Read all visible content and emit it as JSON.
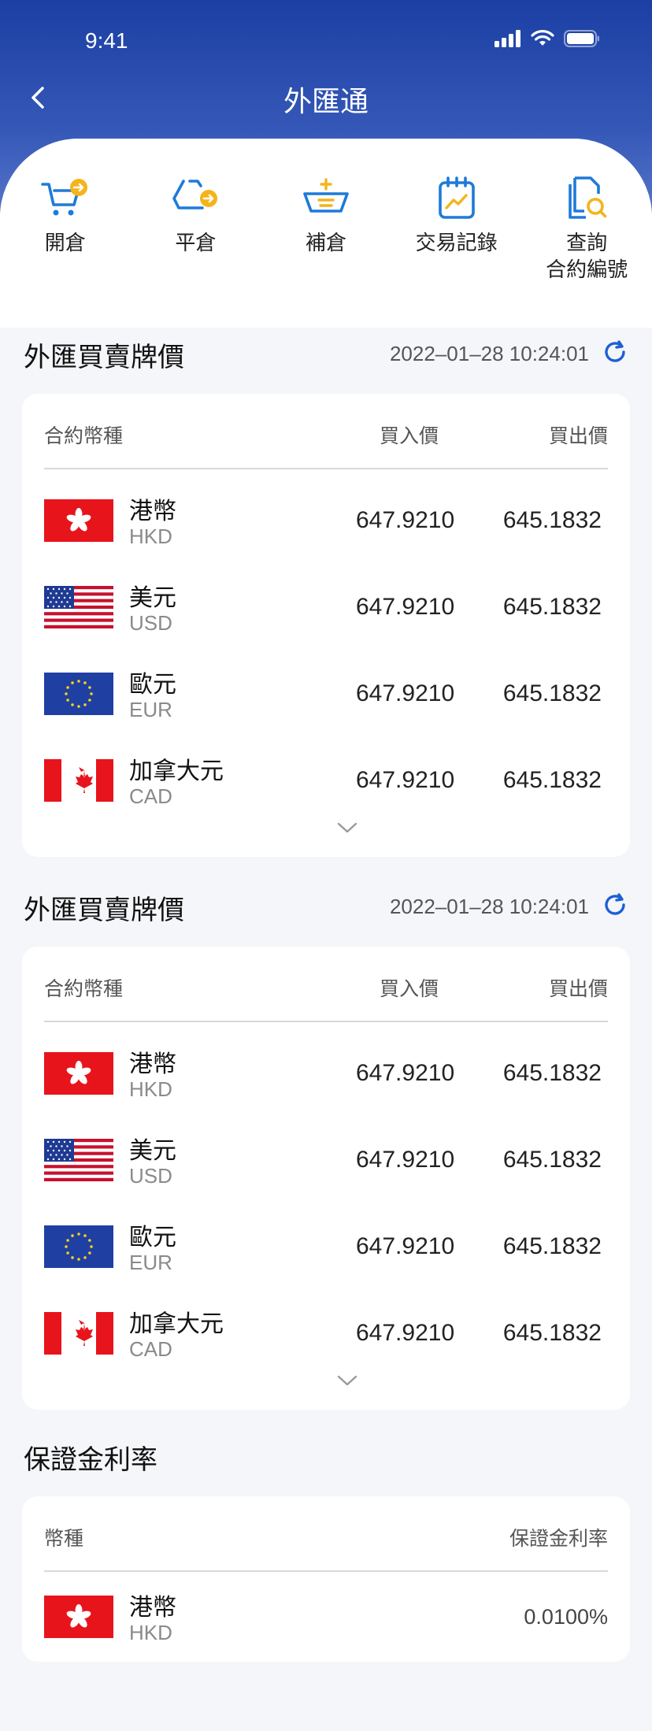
{
  "status_bar": {
    "time": "9:41"
  },
  "nav": {
    "title": "外匯通"
  },
  "quick_actions": [
    {
      "label": "開倉",
      "icon": "open-position-icon"
    },
    {
      "label": "平倉",
      "icon": "close-position-icon"
    },
    {
      "label": "補倉",
      "icon": "top-up-icon"
    },
    {
      "label": "交易記錄",
      "icon": "trade-record-icon"
    },
    {
      "label": "查詢\n合約編號",
      "icon": "search-contract-icon"
    }
  ],
  "rate_sections": [
    {
      "title": "外匯買賣牌價",
      "timestamp": "2022–01–28 10:24:01",
      "headers": {
        "currency": "合約幣種",
        "buy": "買入價",
        "sell": "買出價"
      },
      "rows": [
        {
          "name": "港幣",
          "code": "HKD",
          "buy": "647.9210",
          "sell": "645.1832",
          "flag": "hk-flag-icon"
        },
        {
          "name": "美元",
          "code": "USD",
          "buy": "647.9210",
          "sell": "645.1832",
          "flag": "us-flag-icon"
        },
        {
          "name": "歐元",
          "code": "EUR",
          "buy": "647.9210",
          "sell": "645.1832",
          "flag": "eu-flag-icon"
        },
        {
          "name": "加拿大元",
          "code": "CAD",
          "buy": "647.9210",
          "sell": "645.1832",
          "flag": "ca-flag-icon"
        }
      ]
    },
    {
      "title": "外匯買賣牌價",
      "timestamp": "2022–01–28 10:24:01",
      "headers": {
        "currency": "合約幣種",
        "buy": "買入價",
        "sell": "買出價"
      },
      "rows": [
        {
          "name": "港幣",
          "code": "HKD",
          "buy": "647.9210",
          "sell": "645.1832",
          "flag": "hk-flag-icon"
        },
        {
          "name": "美元",
          "code": "USD",
          "buy": "647.9210",
          "sell": "645.1832",
          "flag": "us-flag-icon"
        },
        {
          "name": "歐元",
          "code": "EUR",
          "buy": "647.9210",
          "sell": "645.1832",
          "flag": "eu-flag-icon"
        },
        {
          "name": "加拿大元",
          "code": "CAD",
          "buy": "647.9210",
          "sell": "645.1832",
          "flag": "ca-flag-icon"
        }
      ]
    }
  ],
  "margin_section": {
    "title": "保證金利率",
    "headers": {
      "currency": "幣種",
      "rate": "保證金利率"
    },
    "rows": [
      {
        "name": "港幣",
        "code": "HKD",
        "rate": "0.0100%",
        "flag": "hk-flag-icon"
      }
    ]
  },
  "colors": {
    "accent": "#1e5fd6",
    "icon_blue": "#1e7ad8",
    "icon_yellow": "#f4b41a",
    "header_dark": "#1b3fa3"
  }
}
